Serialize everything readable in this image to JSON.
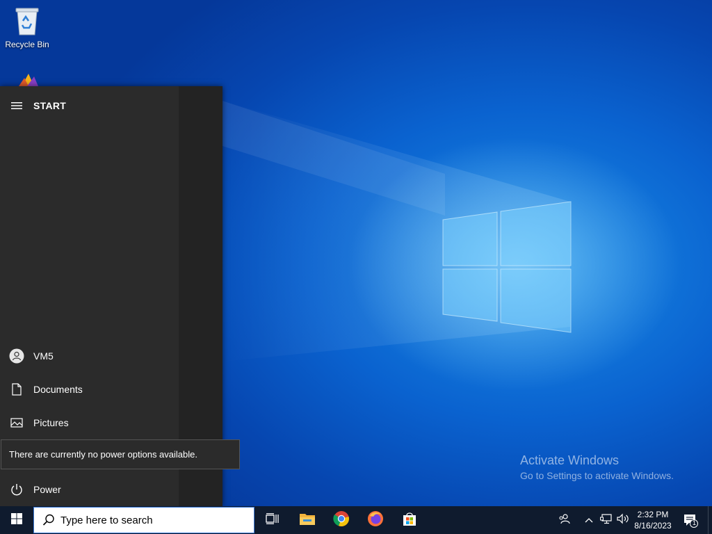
{
  "desktop": {
    "icons": [
      {
        "label": "Recycle Bin",
        "icon": "recycle-bin-icon"
      },
      {
        "label": "",
        "icon": "app-shortcut-icon"
      }
    ]
  },
  "start_menu": {
    "title": "START",
    "items": [
      {
        "label": "VM5",
        "icon": "user-avatar-icon"
      },
      {
        "label": "Documents",
        "icon": "document-icon"
      },
      {
        "label": "Pictures",
        "icon": "pictures-icon"
      },
      {
        "label": "Power",
        "icon": "power-icon"
      }
    ],
    "tooltip": "There are currently no power options available."
  },
  "watermark": {
    "line1": "Activate Windows",
    "line2": "Go to Settings to activate Windows."
  },
  "taskbar": {
    "search_placeholder": "Type here to search",
    "apps": [
      "task-view-icon",
      "file-explorer-icon",
      "chrome-icon",
      "firefox-icon",
      "store-icon"
    ],
    "clock_time": "2:32 PM",
    "clock_date": "8/16/2023",
    "notification_count": "1"
  },
  "colors": {
    "accent": "#0a62cf",
    "start_bg": "#2b2b2b",
    "taskbar_bg": "#0f1b2e"
  }
}
